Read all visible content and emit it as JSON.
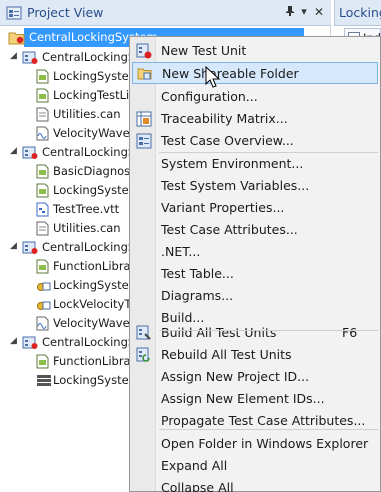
{
  "project_view": {
    "title": "Project View",
    "pin": "📌",
    "dropdown": "▾",
    "close": "✕",
    "tree": [
      {
        "label": "CentralLockingSystem",
        "selected": true
      },
      {
        "label": "CentralLockingSys"
      },
      {
        "label": "LockingSystem"
      },
      {
        "label": "LockingTestLib"
      },
      {
        "label": "Utilities.can"
      },
      {
        "label": "VelocityWavefo"
      },
      {
        "label": "CentralLockingSys"
      },
      {
        "label": "BasicDiagnostic"
      },
      {
        "label": "LockingSystem"
      },
      {
        "label": "TestTree.vtt"
      },
      {
        "label": "Utilities.can"
      },
      {
        "label": "CentralLockingSys"
      },
      {
        "label": "FunctionLibrary"
      },
      {
        "label": "LockingSystem"
      },
      {
        "label": "LockVelocityTe"
      },
      {
        "label": "VelocityWavefo"
      },
      {
        "label": "CentralLockingSys"
      },
      {
        "label": "FunctionLibrary"
      },
      {
        "label": "LockingSystem"
      }
    ]
  },
  "right_panel": {
    "tab_title": "Locking",
    "sub_label": "Ind"
  },
  "context_menu": {
    "items": [
      {
        "label": "New Test Unit",
        "icon": "new-test-unit-icon"
      },
      {
        "label": "New Shareable Folder",
        "icon": "new-folder-icon"
      },
      {
        "label": "Configuration..."
      },
      {
        "label": "Traceability Matrix...",
        "icon": "matrix-icon"
      },
      {
        "label": "Test Case Overview...",
        "icon": "overview-icon"
      },
      {
        "label": "System Environment..."
      },
      {
        "label": "Test System Variables..."
      },
      {
        "label": "Variant Properties..."
      },
      {
        "label": "Test Case Attributes..."
      },
      {
        "label": ".NET..."
      },
      {
        "label": "Test Table..."
      },
      {
        "label": "Diagrams..."
      },
      {
        "label": "Build..."
      },
      {
        "label": "Build All Test Units",
        "shortcut": "F6",
        "icon": "build-icon"
      },
      {
        "label": "Rebuild All Test Units",
        "icon": "rebuild-icon"
      },
      {
        "label": "Assign New Project ID..."
      },
      {
        "label": "Assign New Element IDs..."
      },
      {
        "label": "Propagate Test Case Attributes..."
      },
      {
        "label": "Open Folder in Windows Explorer"
      },
      {
        "label": "Expand All"
      },
      {
        "label": "Collapse All"
      }
    ],
    "hover_index": 1
  }
}
